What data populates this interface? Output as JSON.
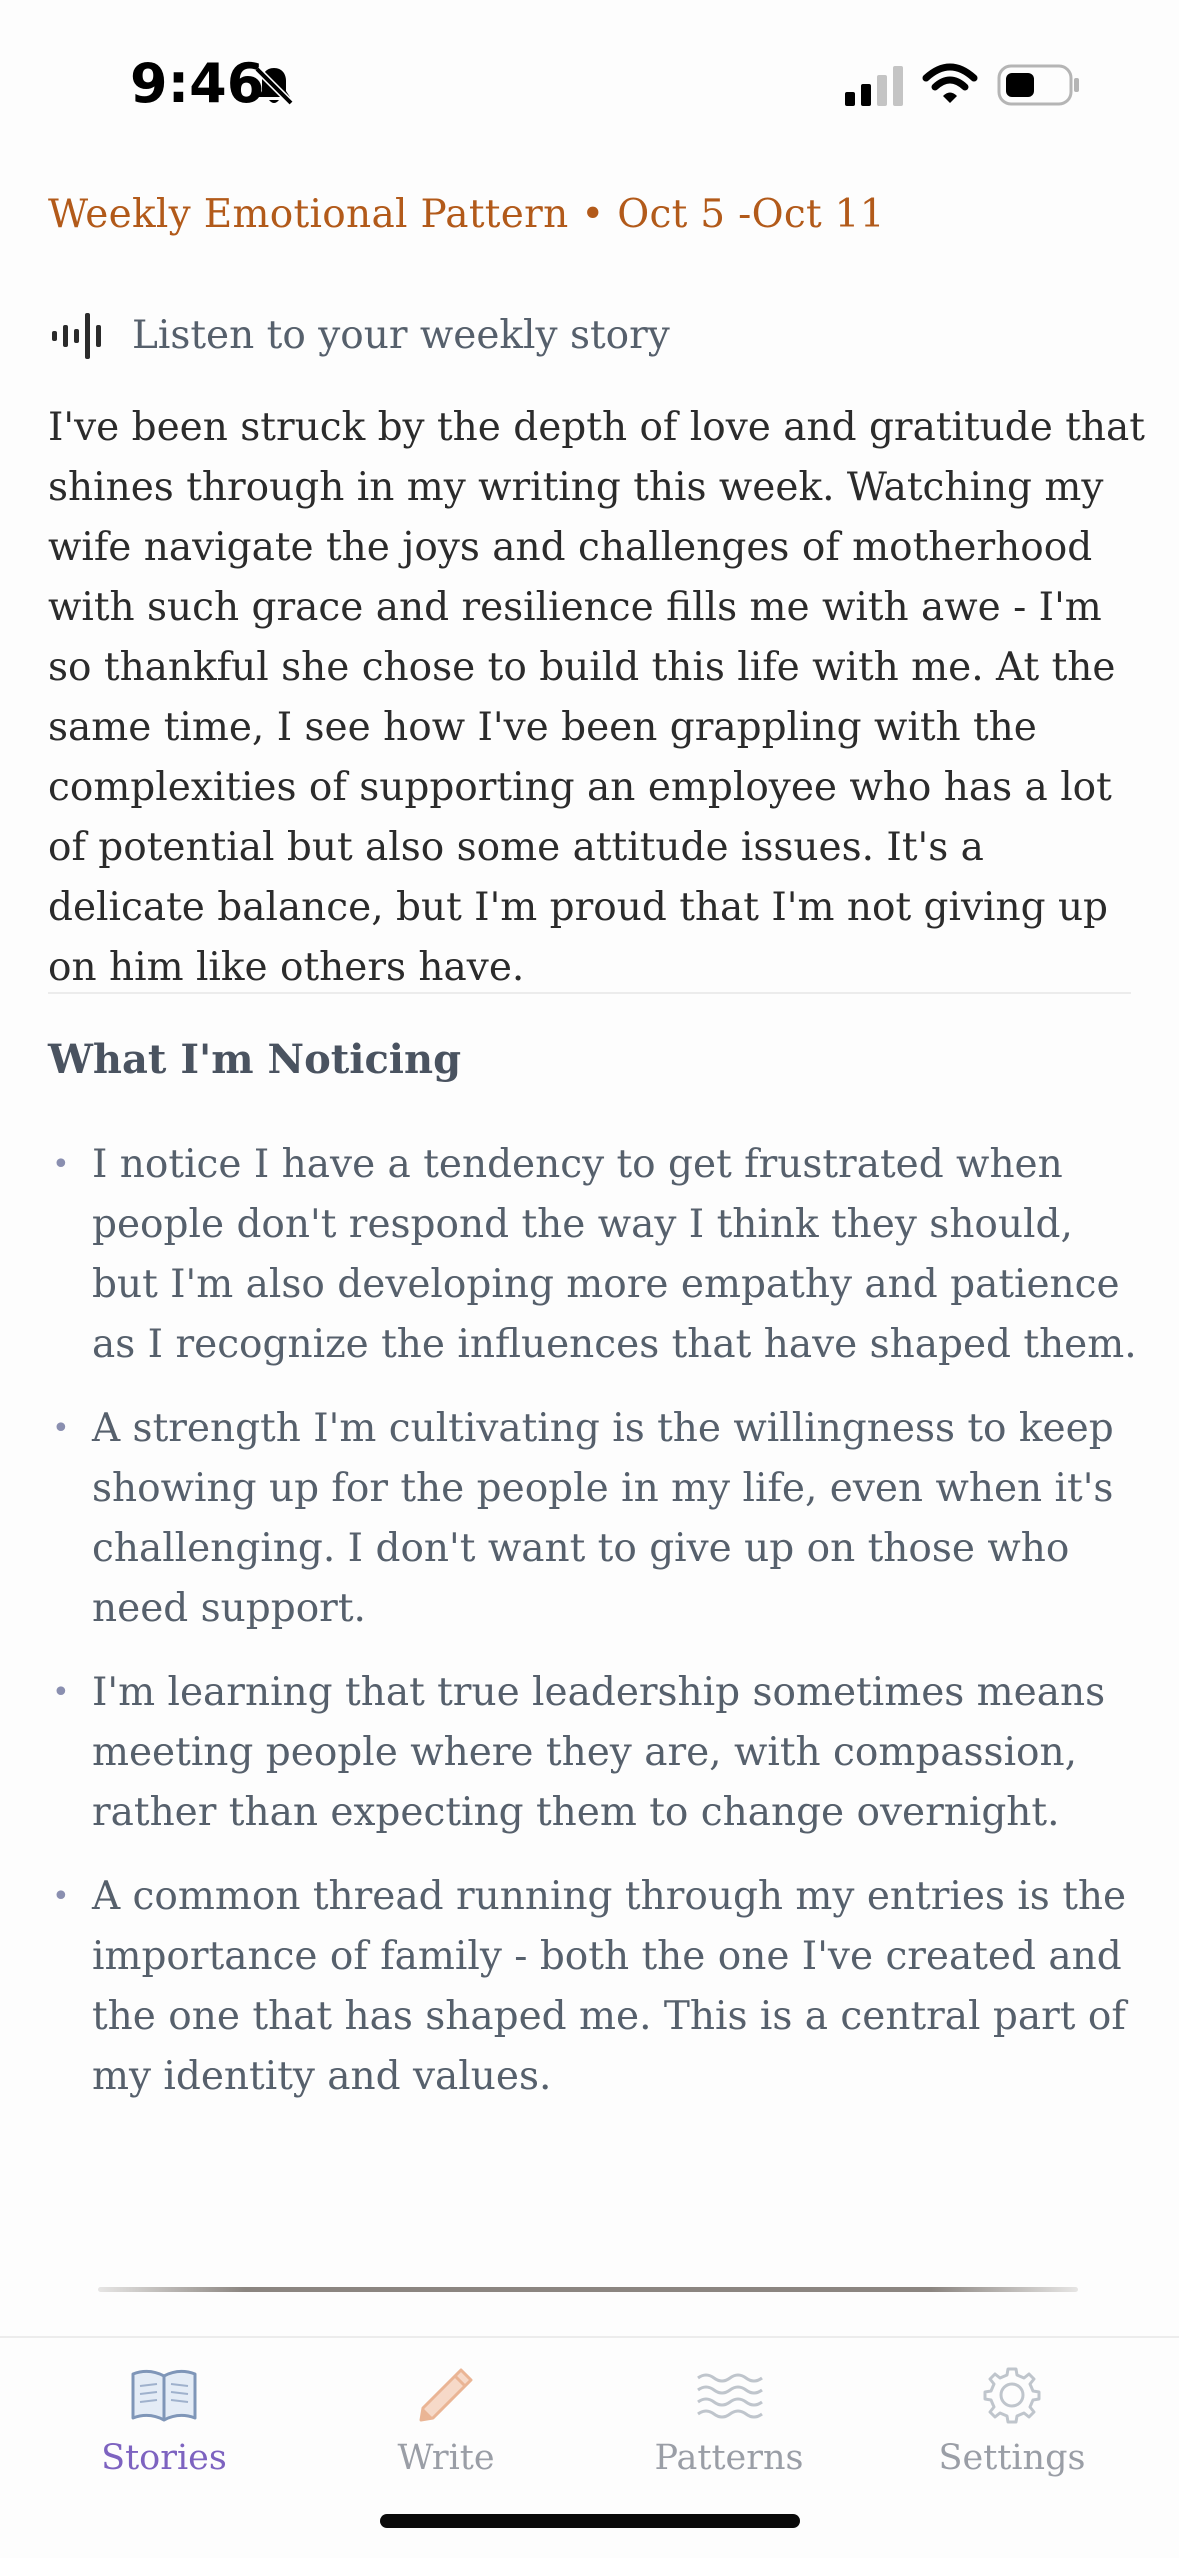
{
  "status_bar": {
    "time": "9:46",
    "icons": [
      "bell-slash-icon",
      "signal-icon",
      "wifi-icon",
      "battery-icon"
    ]
  },
  "header": {
    "title": "Weekly Emotional Pattern • Oct 5 -Oct 11"
  },
  "listen": {
    "icon": "audio-waveform-icon",
    "label": "Listen to your weekly story"
  },
  "story": {
    "text": "I've been struck by the depth of love and gratitude that shines through in my writing this week. Watching my wife navigate the joys and challenges of motherhood with such grace and resilience fills me with awe - I'm so thankful she chose to build this life with me. At the same time, I see how I've been grappling with the complexities of supporting an employee who has a lot of potential but also some attitude issues. It's a delicate balance, but I'm proud that I'm not giving up on him like others have."
  },
  "noticing": {
    "title": "What I'm Noticing",
    "items": [
      "I notice I have a tendency to get frustrated when people don't respond the way I think they should, but I'm also developing more empathy and patience as I recognize the influences that have shaped them.",
      "A strength I'm cultivating is the willingness to keep showing up for the people in my life, even when it's challenging. I don't want to give up on those who need support.",
      "I'm learning that true leadership sometimes means meeting people where they are, with compassion, rather than expecting them to change overnight.",
      "A common thread running through my entries is the importance of family - both the one I've created and the one that has shaped me. This is a central part of my identity and values."
    ]
  },
  "tab_bar": {
    "tabs": [
      {
        "label": "Stories",
        "icon": "open-book-icon",
        "active": true
      },
      {
        "label": "Write",
        "icon": "pencil-icon",
        "active": false
      },
      {
        "label": "Patterns",
        "icon": "waves-icon",
        "active": false
      },
      {
        "label": "Settings",
        "icon": "gear-icon",
        "active": false
      }
    ],
    "colors": {
      "active": "#7d63c0",
      "inactive": "#9a9ea6"
    }
  },
  "colors": {
    "accent_header": "#b25a1a",
    "body_text": "#2b2b2b",
    "muted_text": "#56606c"
  }
}
